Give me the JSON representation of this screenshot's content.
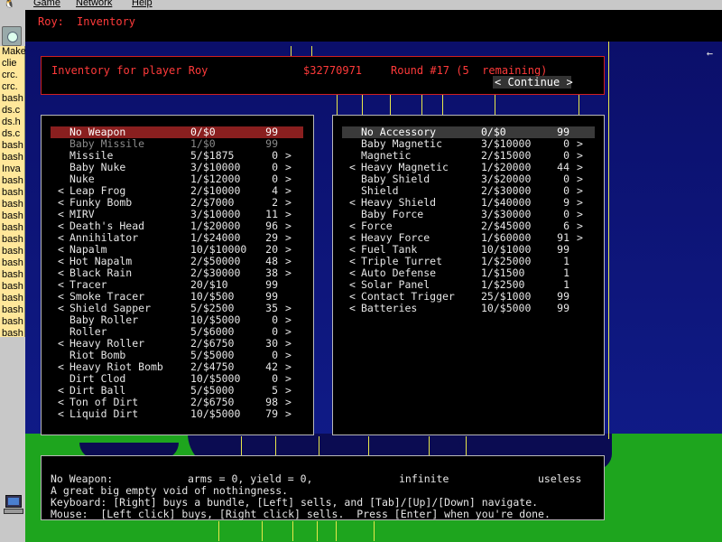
{
  "os_menu": {
    "items": [
      "Game",
      "Network",
      "Help"
    ]
  },
  "taskbar": {
    "tasks": [
      "Make",
      "clie",
      "crc.",
      "crc.",
      "bash",
      "ds.c",
      "ds.h",
      "ds.c",
      "bash",
      "bash",
      "Inva",
      "bash",
      "bash",
      "bash",
      "bash",
      "bash",
      "bash",
      "bash",
      "bash",
      "bash",
      "bash",
      "bash",
      "bash",
      "bash",
      "bash"
    ]
  },
  "header": {
    "player": "Roy:",
    "screen": "Inventory"
  },
  "inventory_info": {
    "title": "Inventory for player Roy",
    "money": "$32770971",
    "round": "Round #17 (5  remaining)",
    "continue_label": "< Continue >"
  },
  "weapons": [
    {
      "l": "",
      "name": "No Weapon",
      "bundle": "0/$0",
      "qty": "99",
      "r": "",
      "state": "selected"
    },
    {
      "l": "",
      "name": "Baby Missile",
      "bundle": "1/$0",
      "qty": "99",
      "r": "",
      "state": "dim"
    },
    {
      "l": "",
      "name": "Missile",
      "bundle": "5/$1875",
      "qty": "0",
      "r": ">",
      "state": ""
    },
    {
      "l": "",
      "name": "Baby Nuke",
      "bundle": "3/$10000",
      "qty": "0",
      "r": ">",
      "state": ""
    },
    {
      "l": "",
      "name": "Nuke",
      "bundle": "1/$12000",
      "qty": "0",
      "r": ">",
      "state": ""
    },
    {
      "l": "<",
      "name": "Leap Frog",
      "bundle": "2/$10000",
      "qty": "4",
      "r": ">",
      "state": ""
    },
    {
      "l": "<",
      "name": "Funky Bomb",
      "bundle": "2/$7000",
      "qty": "2",
      "r": ">",
      "state": ""
    },
    {
      "l": "<",
      "name": "MIRV",
      "bundle": "3/$10000",
      "qty": "11",
      "r": ">",
      "state": ""
    },
    {
      "l": "<",
      "name": "Death's Head",
      "bundle": "1/$20000",
      "qty": "96",
      "r": ">",
      "state": ""
    },
    {
      "l": "<",
      "name": "Annihilator",
      "bundle": "1/$24000",
      "qty": "29",
      "r": ">",
      "state": ""
    },
    {
      "l": "<",
      "name": "Napalm",
      "bundle": "10/$10000",
      "qty": "20",
      "r": ">",
      "state": ""
    },
    {
      "l": "<",
      "name": "Hot Napalm",
      "bundle": "2/$50000",
      "qty": "48",
      "r": ">",
      "state": ""
    },
    {
      "l": "<",
      "name": "Black Rain",
      "bundle": "2/$30000",
      "qty": "38",
      "r": ">",
      "state": ""
    },
    {
      "l": "<",
      "name": "Tracer",
      "bundle": "20/$10",
      "qty": "99",
      "r": "",
      "state": ""
    },
    {
      "l": "<",
      "name": "Smoke Tracer",
      "bundle": "10/$500",
      "qty": "99",
      "r": "",
      "state": ""
    },
    {
      "l": "<",
      "name": "Shield Sapper",
      "bundle": "5/$2500",
      "qty": "35",
      "r": ">",
      "state": ""
    },
    {
      "l": "",
      "name": "Baby Roller",
      "bundle": "10/$5000",
      "qty": "0",
      "r": ">",
      "state": ""
    },
    {
      "l": "",
      "name": "Roller",
      "bundle": "5/$6000",
      "qty": "0",
      "r": ">",
      "state": ""
    },
    {
      "l": "<",
      "name": "Heavy Roller",
      "bundle": "2/$6750",
      "qty": "30",
      "r": ">",
      "state": ""
    },
    {
      "l": "",
      "name": "Riot Bomb",
      "bundle": "5/$5000",
      "qty": "0",
      "r": ">",
      "state": ""
    },
    {
      "l": "<",
      "name": "Heavy Riot Bomb",
      "bundle": "2/$4750",
      "qty": "42",
      "r": ">",
      "state": ""
    },
    {
      "l": "",
      "name": "Dirt Clod",
      "bundle": "10/$5000",
      "qty": "0",
      "r": ">",
      "state": ""
    },
    {
      "l": "<",
      "name": "Dirt Ball",
      "bundle": "5/$5000",
      "qty": "5",
      "r": ">",
      "state": ""
    },
    {
      "l": "<",
      "name": "Ton of Dirt",
      "bundle": "2/$6750",
      "qty": "98",
      "r": ">",
      "state": ""
    },
    {
      "l": "<",
      "name": "Liquid Dirt",
      "bundle": "10/$5000",
      "qty": "79",
      "r": ">",
      "state": ""
    }
  ],
  "accessories": [
    {
      "l": "",
      "name": "No Accessory",
      "bundle": "0/$0",
      "qty": "99",
      "r": "",
      "state": "selected"
    },
    {
      "l": "",
      "name": "Baby Magnetic",
      "bundle": "3/$10000",
      "qty": "0",
      "r": ">",
      "state": ""
    },
    {
      "l": "",
      "name": "Magnetic",
      "bundle": "2/$15000",
      "qty": "0",
      "r": ">",
      "state": ""
    },
    {
      "l": "<",
      "name": "Heavy Magnetic",
      "bundle": "1/$20000",
      "qty": "44",
      "r": ">",
      "state": ""
    },
    {
      "l": "",
      "name": "Baby Shield",
      "bundle": "3/$20000",
      "qty": "0",
      "r": ">",
      "state": ""
    },
    {
      "l": "",
      "name": "Shield",
      "bundle": "2/$30000",
      "qty": "0",
      "r": ">",
      "state": ""
    },
    {
      "l": "<",
      "name": "Heavy Shield",
      "bundle": "1/$40000",
      "qty": "9",
      "r": ">",
      "state": ""
    },
    {
      "l": "",
      "name": "Baby Force",
      "bundle": "3/$30000",
      "qty": "0",
      "r": ">",
      "state": ""
    },
    {
      "l": "<",
      "name": "Force",
      "bundle": "2/$45000",
      "qty": "6",
      "r": ">",
      "state": ""
    },
    {
      "l": "<",
      "name": "Heavy Force",
      "bundle": "1/$60000",
      "qty": "91",
      "r": ">",
      "state": ""
    },
    {
      "l": "<",
      "name": "Fuel Tank",
      "bundle": "10/$1000",
      "qty": "99",
      "r": "",
      "state": ""
    },
    {
      "l": "<",
      "name": "Triple Turret",
      "bundle": "1/$25000",
      "qty": "1",
      "r": "",
      "state": ""
    },
    {
      "l": "<",
      "name": "Auto Defense",
      "bundle": "1/$1500",
      "qty": "1",
      "r": "",
      "state": ""
    },
    {
      "l": "<",
      "name": "Solar Panel",
      "bundle": "1/$2500",
      "qty": "1",
      "r": "",
      "state": ""
    },
    {
      "l": "<",
      "name": "Contact Trigger",
      "bundle": "25/$1000",
      "qty": "99",
      "r": "",
      "state": ""
    },
    {
      "l": "<",
      "name": "Batteries",
      "bundle": "10/$5000",
      "qty": "99",
      "r": "",
      "state": ""
    }
  ],
  "description": {
    "item": "No Weapon:",
    "stats": "arms = 0, yield = 0,",
    "duration": "infinite",
    "rating": "useless",
    "flavor": "A great big empty void of nothingness.",
    "keyboard_help": "Keyboard: [Right] buys a bundle, [Left] sells, and [Tab]/[Up]/[Down] navigate.",
    "mouse_help": "Mouse:  [Left click] buys, [Right click] sells.  Press [Enter] when you're done."
  },
  "colors": {
    "header_red": "#ff3a3a",
    "selected_weapon": "#8a1f1f",
    "selected_accessory": "#3a3a3a",
    "sky": "#0b0f6a",
    "ground": "#1ea51e"
  }
}
